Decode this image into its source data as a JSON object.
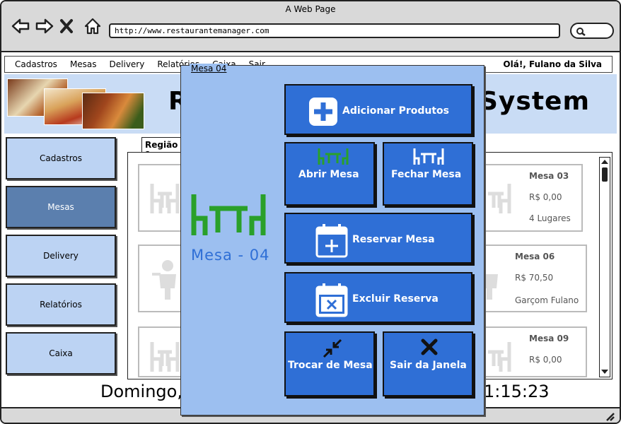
{
  "browser": {
    "window_title": "A Web Page",
    "url": "http://www.restaurantemanager.com"
  },
  "menu": {
    "items": [
      "Cadastros",
      "Mesas",
      "Delivery",
      "Relatórios",
      "Caixa",
      "Sair"
    ],
    "greeting": "Olá!, Fulano da Silva"
  },
  "banner": {
    "title_left": "R",
    "title_right": "System"
  },
  "sidebar": {
    "items": [
      "Cadastros",
      "Mesas",
      "Delivery",
      "Relatórios",
      "Caixa"
    ],
    "active": "Mesas"
  },
  "region_tab": "Região 1",
  "cards": [
    {
      "title": "Mesa 03",
      "line1": "R$ 0,00",
      "line2": "4 Lugares"
    },
    {
      "title": "Mesa 06",
      "line1": "R$ 70,50",
      "line2": "Garçom Fulano"
    },
    {
      "title": "Mesa 09",
      "line1": "R$ 0,00",
      "line2": ""
    }
  ],
  "footer": {
    "date": "Domingo,",
    "time": "1:15:23"
  },
  "modal": {
    "title": "Mesa 04",
    "name": "Mesa - 04",
    "buttons": {
      "add_products": "Adicionar Produtos",
      "open_table": "Abrir Mesa",
      "close_table": "Fechar Mesa",
      "reserve_table": "Reservar Mesa",
      "delete_reservation": "Excluir Reserva",
      "change_table": "Trocar de Mesa",
      "exit_window": "Sair da Janela"
    }
  },
  "colors": {
    "accent": "#2f6fd6",
    "modal_bg": "#9cbff0",
    "sidebar_bg": "#bcd3f3",
    "sidebar_active": "#5b7fae",
    "open_icon": "#2aa02a"
  }
}
